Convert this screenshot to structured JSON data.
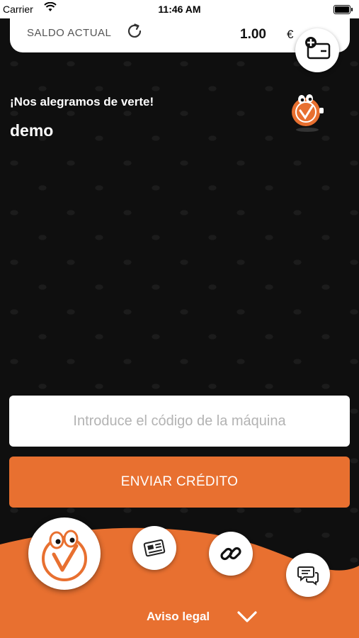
{
  "status_bar": {
    "carrier": "Carrier",
    "time": "11:46 AM"
  },
  "balance": {
    "label": "SALDO ACTUAL",
    "amount": "1.00",
    "currency": "€"
  },
  "greeting": {
    "welcome": "¡Nos alegramos de verte!",
    "username": "demo"
  },
  "form": {
    "code_placeholder": "Introduce el código de la máquina",
    "send_label": "ENVIAR CRÉDITO"
  },
  "footer": {
    "legal_label": "Aviso legal"
  },
  "colors": {
    "accent": "#e87030",
    "background": "#0f0f0f",
    "surface": "#ffffff"
  },
  "icons": [
    "wifi-icon",
    "battery-icon",
    "refresh-icon",
    "add-card-icon",
    "mascot-icon",
    "news-icon",
    "link-icon",
    "chat-icon",
    "chevron-down-icon"
  ]
}
